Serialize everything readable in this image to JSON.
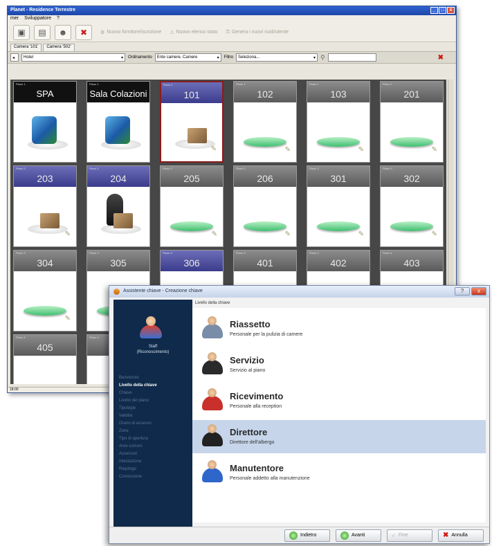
{
  "main": {
    "title": "Planet - Residence Terrestre",
    "menu": [
      "mer",
      "Sviluppatore",
      "?"
    ],
    "toolbar": {
      "icons": [
        "save-icon",
        "document-icon",
        "users-icon",
        "delete-icon"
      ],
      "links": [
        "Nuovo fornitore/iscrizione",
        "Nuovo elenco stato",
        "Genera i nuovi ruoli/utente"
      ]
    },
    "tabs": [
      "Camera '101'",
      "Camera '502'"
    ],
    "filter": {
      "building": "Hotel",
      "sort_label": "Ordinamento",
      "sort_value": "Ente camere, Camere",
      "filter_label": "Filtro",
      "filter_value": "Seleziona...",
      "search_value": ""
    },
    "status": "18:00",
    "rooms": [
      {
        "floor": "Piano 1",
        "name": "SPA",
        "head": "black",
        "icon": "product"
      },
      {
        "floor": "Piano 1",
        "name": "Sala Colazioni",
        "head": "black",
        "icon": "product"
      },
      {
        "floor": "Piano 1",
        "name": "101",
        "head": "blue",
        "icon": "boxes",
        "selected": true
      },
      {
        "floor": "Piano 1",
        "name": "102",
        "head": "gray",
        "icon": "green"
      },
      {
        "floor": "Piano 1",
        "name": "103",
        "head": "gray",
        "icon": "green"
      },
      {
        "floor": "Piano 2",
        "name": "201",
        "head": "gray",
        "icon": "green"
      },
      {
        "floor": "Piano 2",
        "name": "203",
        "head": "blue",
        "icon": "boxes"
      },
      {
        "floor": "Piano 2",
        "name": "204",
        "head": "blue",
        "icon": "person"
      },
      {
        "floor": "Piano 2",
        "name": "205",
        "head": "gray",
        "icon": "green"
      },
      {
        "floor": "Piano 2",
        "name": "206",
        "head": "gray",
        "icon": "green"
      },
      {
        "floor": "Piano 3",
        "name": "301",
        "head": "gray",
        "icon": "green"
      },
      {
        "floor": "Piano 3",
        "name": "302",
        "head": "gray",
        "icon": "green"
      },
      {
        "floor": "Piano 3",
        "name": "304",
        "head": "gray",
        "icon": "green"
      },
      {
        "floor": "Piano 3",
        "name": "305",
        "head": "gray",
        "icon": "green"
      },
      {
        "floor": "Piano 3",
        "name": "306",
        "head": "blue",
        "icon": "none"
      },
      {
        "floor": "Piano 4",
        "name": "401",
        "head": "gray",
        "icon": "none"
      },
      {
        "floor": "Piano 4",
        "name": "402",
        "head": "gray",
        "icon": "none"
      },
      {
        "floor": "Piano 4",
        "name": "403",
        "head": "gray",
        "icon": "none"
      },
      {
        "floor": "Piano 4",
        "name": "405",
        "head": "gray",
        "icon": "none"
      },
      {
        "floor": "Piano 4",
        "name": "",
        "head": "gray",
        "icon": "none"
      }
    ]
  },
  "dialog": {
    "title": "Assistente chiave - Creazione chiave",
    "pane_header": "Livello della chiave",
    "user": {
      "name": "Staff",
      "sub": "(Riconoscimento)"
    },
    "steps": [
      "Benvenuto",
      "Livello della chiave",
      "Chiave",
      "Livello del piano",
      "Tipologie",
      "Validità",
      "Orario di accesso",
      "Zone",
      "Tipo di apertura",
      "Aree comuni",
      "Ascensori",
      "Intestazione",
      "Riepilogo",
      "Conclusione"
    ],
    "current_step": 1,
    "roles": [
      {
        "title": "Riassetto",
        "desc": "Personale per la pulizia di camere",
        "color": "#7a8da8"
      },
      {
        "title": "Servizio",
        "desc": "Servizio al piano",
        "color": "#2a2a2a"
      },
      {
        "title": "Ricevimento",
        "desc": "Personale alla reception",
        "color": "#c9302c"
      },
      {
        "title": "Direttore",
        "desc": "Direttore dell'albergo",
        "color": "#222222"
      },
      {
        "title": "Manutentore",
        "desc": "Personale addetto alla manutenzione",
        "color": "#2f66c9"
      }
    ],
    "selected_role": 3,
    "buttons": {
      "back": "Indietro",
      "next": "Avanti",
      "finish": "Fine",
      "cancel": "Annulla"
    }
  }
}
